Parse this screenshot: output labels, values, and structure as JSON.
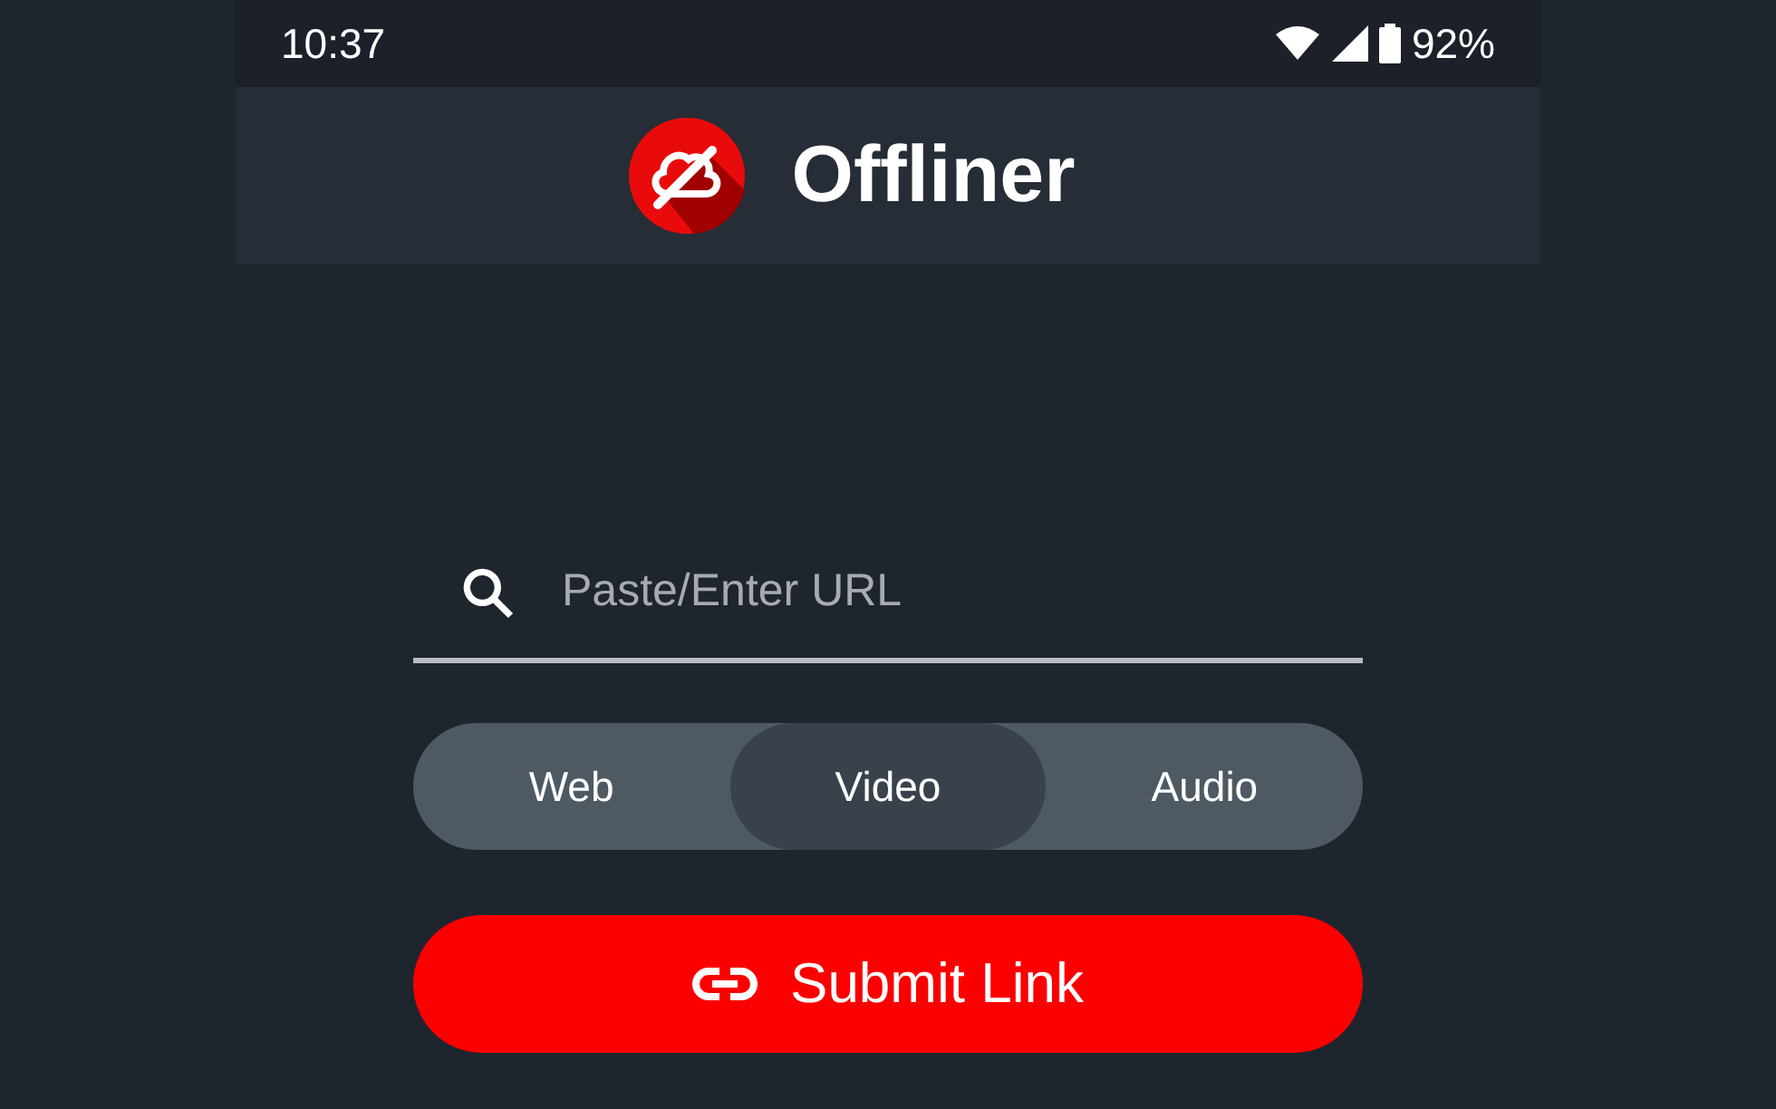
{
  "status_bar": {
    "time": "10:37",
    "battery": "92%"
  },
  "app_bar": {
    "title": "Offliner"
  },
  "search": {
    "placeholder": "Paste/Enter URL"
  },
  "modes": [
    {
      "label": "Web",
      "selected": false
    },
    {
      "label": "Video",
      "selected": true
    },
    {
      "label": "Audio",
      "selected": false
    }
  ],
  "submit_button": {
    "label": "Submit Link"
  }
}
